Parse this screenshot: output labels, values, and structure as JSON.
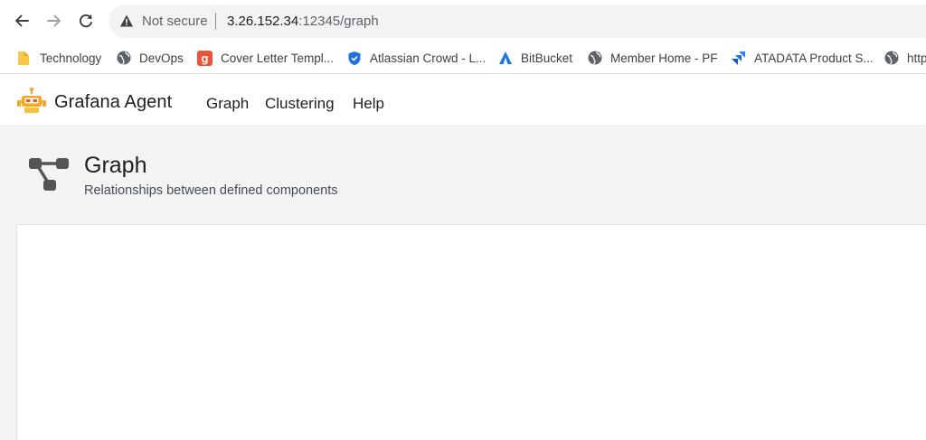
{
  "browser": {
    "security_label": "Not secure",
    "url_host": "3.26.152.34",
    "url_rest": ":12345/graph"
  },
  "bookmarks": [
    {
      "label": "Technology",
      "icon": "folder-icon"
    },
    {
      "label": "DevOps",
      "icon": "globe-icon"
    },
    {
      "label": "Cover Letter Templ...",
      "icon": "g-favicon"
    },
    {
      "label": "Atlassian Crowd - L...",
      "icon": "shield-favicon"
    },
    {
      "label": "BitBucket",
      "icon": "bitbucket-favicon"
    },
    {
      "label": "Member Home - PF",
      "icon": "globe-icon"
    },
    {
      "label": "ATADATA Product S...",
      "icon": "jira-favicon"
    },
    {
      "label": "http",
      "icon": "globe-icon"
    }
  ],
  "app": {
    "brand": "Grafana Agent",
    "nav": [
      "Graph",
      "Clustering",
      "Help"
    ]
  },
  "page": {
    "title": "Graph",
    "subtitle": "Relationships between defined components"
  },
  "colors": {
    "brand_orange": "#f5a623",
    "page_bg": "#f3f3f3",
    "panel_bg": "#ffffff",
    "icon_gray": "#555555"
  }
}
